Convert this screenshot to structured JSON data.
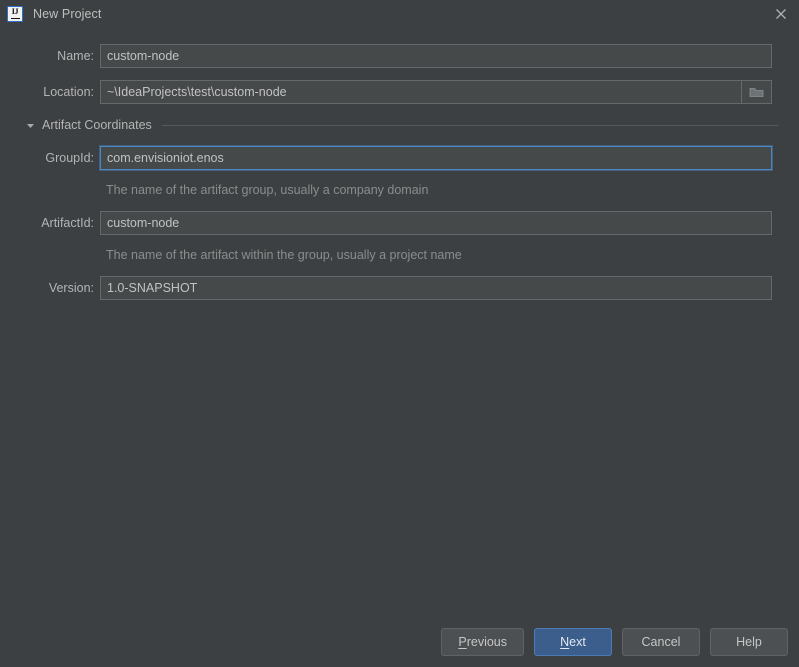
{
  "window": {
    "title": "New Project",
    "icon": "intellij-idea-icon",
    "close_label": "✕"
  },
  "form": {
    "name": {
      "label": "Name:",
      "value": "custom-node",
      "placeholder": ""
    },
    "location": {
      "label": "Location:",
      "value": "~\\IdeaProjects\\test\\custom-node",
      "placeholder": "",
      "browse_icon": "folder-icon"
    },
    "artifact_section": {
      "title": "Artifact Coordinates",
      "expanded": true,
      "arrow_icon": "triangle-down-icon"
    },
    "group_id": {
      "label": "GroupId:",
      "value": "com.envisioniot.enos",
      "placeholder": "",
      "hint": "The name of the artifact group, usually a company domain",
      "focused": true
    },
    "artifact_id": {
      "label": "ArtifactId:",
      "value": "custom-node",
      "placeholder": "",
      "hint": "The name of the artifact within the group, usually a project name",
      "focused": false
    },
    "version": {
      "label": "Version:",
      "value": "1.0-SNAPSHOT",
      "placeholder": "",
      "focused": false
    }
  },
  "buttons": {
    "previous": {
      "mnemonic": "P",
      "rest": "revious"
    },
    "next": {
      "mnemonic": "N",
      "rest": "ext"
    },
    "cancel": {
      "label": "Cancel"
    },
    "help": {
      "label": "Help"
    }
  },
  "colors": {
    "background": "#3c4042",
    "field_background": "#45494a",
    "field_border": "#646a6c",
    "focus_border": "#4b87c4",
    "primary_button": "#3c5e8c",
    "primary_button_border": "#4d7cb5",
    "text": "#bbbbbb",
    "hint_text": "#8c8c8c"
  }
}
